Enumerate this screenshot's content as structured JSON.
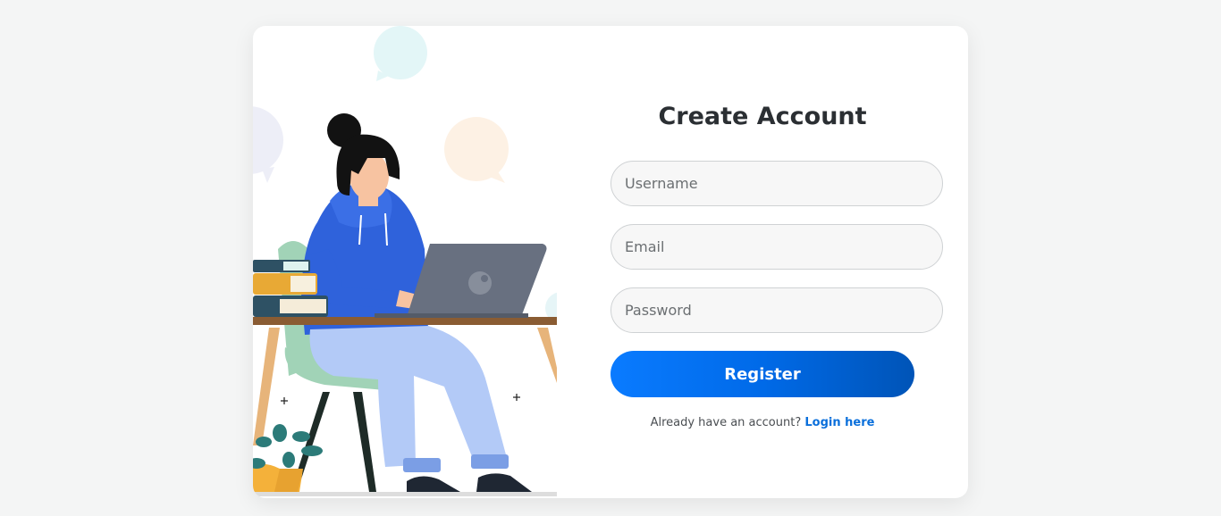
{
  "form": {
    "title": "Create Account",
    "username_placeholder": "Username",
    "email_placeholder": "Email",
    "password_placeholder": "Password",
    "register_label": "Register",
    "login_prompt": "Already have an account?",
    "login_link": "Login here"
  },
  "colors": {
    "primary": "#007bff",
    "primary_dark": "#0054b7",
    "background": "#f4f5f5",
    "card": "#ffffff"
  }
}
